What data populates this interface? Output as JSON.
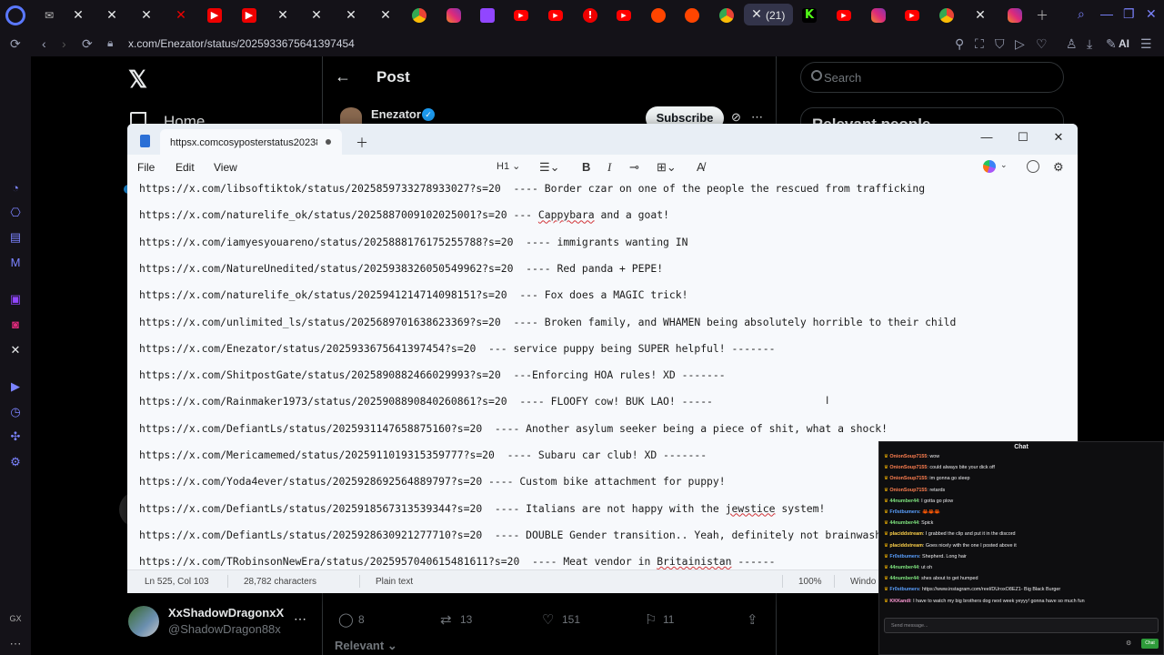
{
  "browser": {
    "url": "x.com/Enezator/status/2025933675641397454",
    "active_tab_label": "(21)",
    "ai_label": "AI"
  },
  "x": {
    "home_label": "Home",
    "post_title": "Post",
    "author_name": "Enezator",
    "subscribe_label": "Subscribe",
    "search_placeholder": "Search",
    "relevant_heading": "Relevant people",
    "profile_name": "XxShadowDragonxX",
    "profile_handle": "@ShadowDragon88x",
    "actions": {
      "replies": "8",
      "reposts": "13",
      "likes": "151",
      "bookmarks": "11"
    },
    "sort_label": "Relevant"
  },
  "notepad": {
    "tab_title": "httpsx.comcosyposterstatus2023828",
    "menu": [
      "File",
      "Edit",
      "View"
    ],
    "heading_selector": "H1",
    "lines": [
      {
        "pre": "https://x.com/libsoftiktok/status/2025859733278933027?s=20  ---- Border czar on one of the people the rescued from trafficking",
        "sq": "",
        "post": ""
      },
      {
        "pre": "https://x.com/naturelife_ok/status/2025887009102025001?s=20 --- ",
        "sq": "Cappybara",
        "post": " and a goat!"
      },
      {
        "pre": "https://x.com/iamyesyouareno/status/2025888176175255788?s=20  ---- immigrants wanting IN",
        "sq": "",
        "post": ""
      },
      {
        "pre": "https://x.com/NatureUnedited/status/2025938326050549962?s=20  ---- Red panda + PEPE!",
        "sq": "",
        "post": ""
      },
      {
        "pre": "https://x.com/naturelife_ok/status/2025941214714098151?s=20  --- Fox does a MAGIC trick!",
        "sq": "",
        "post": ""
      },
      {
        "pre": "https://x.com/unlimited_ls/status/2025689701638623369?s=20  ---- Broken family, and WHAMEN being absolutely horrible to their child",
        "sq": "",
        "post": ""
      },
      {
        "pre": "https://x.com/Enezator/status/2025933675641397454?s=20  --- service puppy being SUPER helpful! -------",
        "sq": "",
        "post": ""
      },
      {
        "pre": "https://x.com/ShitpostGate/status/2025890882466029993?s=20  ---Enforcing HOA rules! XD -------",
        "sq": "",
        "post": ""
      },
      {
        "pre": "https://x.com/Rainmaker1973/status/2025908890840260861?s=20  ---- FLOOFY cow! BUK LAO! -----",
        "sq": "",
        "post": ""
      },
      {
        "pre": "https://x.com/DefiantLs/status/2025931147658875160?s=20  ---- Another asylum seeker being a piece of shit, what a shock!",
        "sq": "",
        "post": ""
      },
      {
        "pre": "https://x.com/Mericamemed/status/2025911019315359777?s=20  ---- Subaru car club! XD -------",
        "sq": "",
        "post": ""
      },
      {
        "pre": "https://x.com/Yoda4ever/status/2025928692564889797?s=20 ---- Custom bike attachment for puppy!",
        "sq": "",
        "post": ""
      },
      {
        "pre": "https://x.com/DefiantLs/status/2025918567313539344?s=20  ---- Italians are not happy with the ",
        "sq": "jewstice",
        "post": " system!"
      },
      {
        "pre": "https://x.com/DefiantLs/status/2025928630921277710?s=20  ---- DOUBLE Gender transition.. Yeah, definitely not brainwashing",
        "sq": "",
        "post": ""
      },
      {
        "pre": "https://x.com/TRobinsonNewEra/status/2025957040615481611?s=20  ---- Meat vendor in ",
        "sq": "Britainistan",
        "post": " ------"
      }
    ],
    "status": {
      "position": "Ln 525, Col 103",
      "chars": "28,782 characters",
      "format": "Plain text",
      "zoom": "100%",
      "eol": "Windo"
    }
  },
  "chat": {
    "title": "Chat",
    "messages": [
      {
        "user": "OnionSoup7155",
        "color": "#ff7f50",
        "text": "wow"
      },
      {
        "user": "OnionSoup7155",
        "color": "#ff7f50",
        "text": "could always bite your dick off"
      },
      {
        "user": "OnionSoup7155",
        "color": "#ff7f50",
        "text": "im gonna go sleep"
      },
      {
        "user": "OnionSoup7155",
        "color": "#ff7f50",
        "text": "retards"
      },
      {
        "user": "44number44",
        "color": "#7fe57f",
        "text": "I gotta go plow"
      },
      {
        "user": "Fr0stbumers",
        "color": "#5aa0ff",
        "text": "🦀🦀🦀"
      },
      {
        "user": "44number44",
        "color": "#7fe57f",
        "text": "Spick"
      },
      {
        "user": "placiddstream",
        "color": "#ffd24a",
        "text": "I grabbed the clip and put it in the discord"
      },
      {
        "user": "placiddstream",
        "color": "#ffd24a",
        "text": "Goes nicely with the one I posted above it"
      },
      {
        "user": "Fr0stbumers",
        "color": "#5aa0ff",
        "text": "Shepherd. Long hair"
      },
      {
        "user": "44number44",
        "color": "#7fe57f",
        "text": "ut oh"
      },
      {
        "user": "44number44",
        "color": "#7fe57f",
        "text": "shes about to get humped"
      },
      {
        "user": "Fr0stbumers",
        "color": "#5aa0ff",
        "text": "https://www.instagram.com/reel/DUroxO8EZ1- Big Black Burger"
      },
      {
        "user": "KKKandi",
        "color": "#ff9ad5",
        "text": "I have to watch my big brothers dog next week yeyyy! gonna have so much fun"
      }
    ],
    "input_placeholder": "Send message...",
    "send_label": "Chat"
  }
}
